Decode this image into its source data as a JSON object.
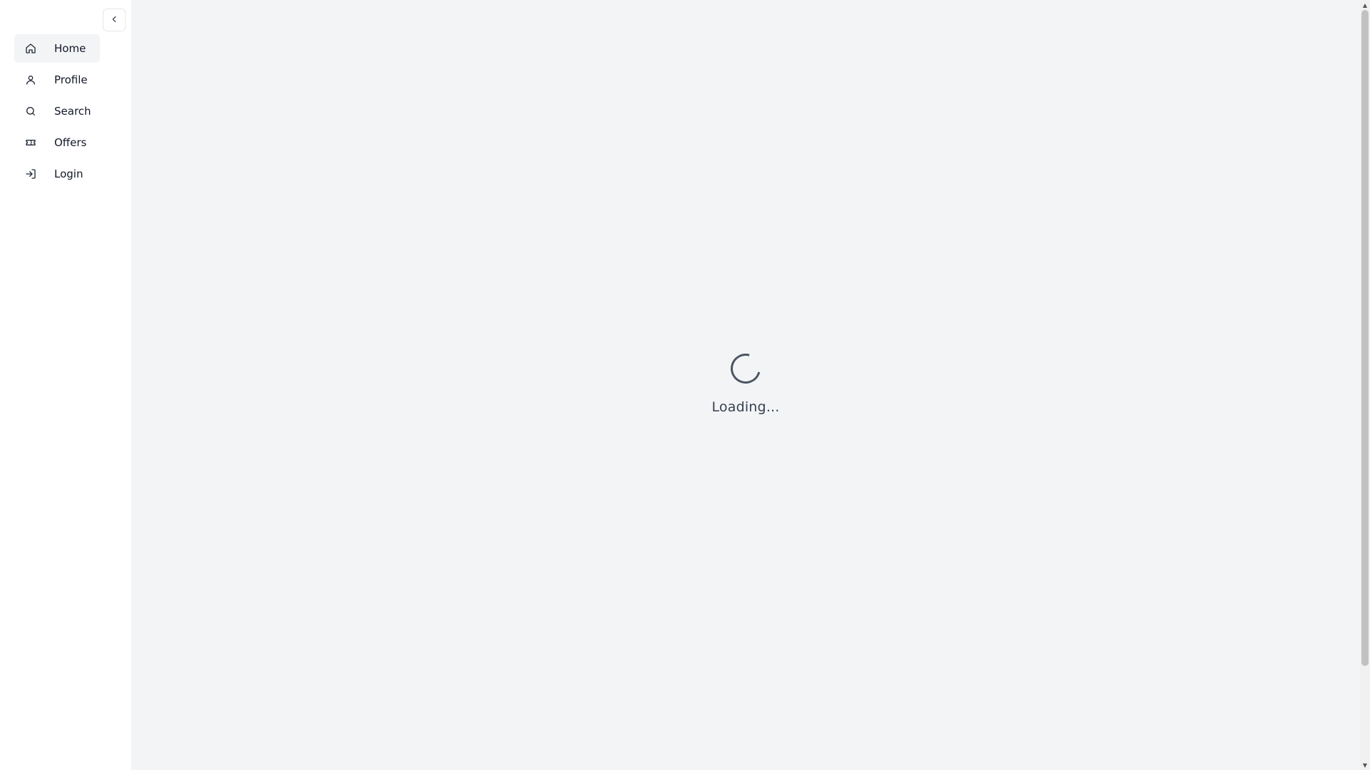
{
  "sidebar": {
    "collapse_icon": "chevron-left-icon",
    "items": [
      {
        "label": "Home",
        "icon": "home-icon",
        "active": true
      },
      {
        "label": "Profile",
        "icon": "user-icon",
        "active": false
      },
      {
        "label": "Search",
        "icon": "search-icon",
        "active": false
      },
      {
        "label": "Offers",
        "icon": "ticket-icon",
        "active": false
      },
      {
        "label": "Login",
        "icon": "login-icon",
        "active": false
      }
    ]
  },
  "main": {
    "loading_text": "Loading..."
  },
  "colors": {
    "sidebar_bg": "#ffffff",
    "main_bg": "#f3f4f6",
    "active_item_bg": "#f3f4f6",
    "spinner": "#4b5563"
  }
}
